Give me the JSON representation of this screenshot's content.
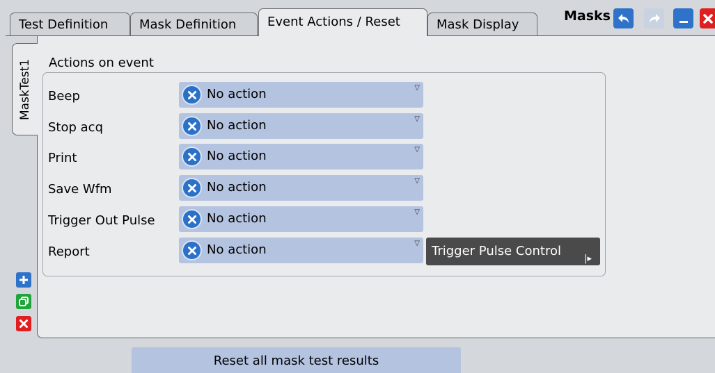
{
  "tabs": [
    {
      "label": "Test Definition"
    },
    {
      "label": "Mask Definition"
    },
    {
      "label": "Event Actions / Reset"
    },
    {
      "label": "Mask Display"
    }
  ],
  "dialog": {
    "title": "Masks",
    "buttons": {
      "undo": "undo-icon",
      "redo": "redo-icon",
      "minimize": "minimize-icon",
      "close": "close-icon"
    }
  },
  "side_tab": {
    "label": "MaskTest1"
  },
  "section": {
    "title": "Actions on event"
  },
  "actions": [
    {
      "label": "Beep",
      "value": "No action"
    },
    {
      "label": "Stop acq",
      "value": "No action"
    },
    {
      "label": "Print",
      "value": "No action"
    },
    {
      "label": "Save Wfm",
      "value": "No action"
    },
    {
      "label": "Trigger Out Pulse",
      "value": "No action"
    },
    {
      "label": "Report",
      "value": "No action"
    }
  ],
  "trigger_pulse_control": {
    "label": "Trigger Pulse Control"
  },
  "side_buttons": {
    "add": "add-icon",
    "copy": "copy-icon",
    "delete": "delete-icon"
  },
  "reset_button": {
    "label": "Reset all mask test results"
  },
  "colors": {
    "background": "#d4d8dc",
    "panel": "#e9ebed",
    "dropdown": "#b4c3e0",
    "accent_blue": "#2b71c8",
    "close_red": "#e02020",
    "copy_green": "#1fa53a"
  }
}
